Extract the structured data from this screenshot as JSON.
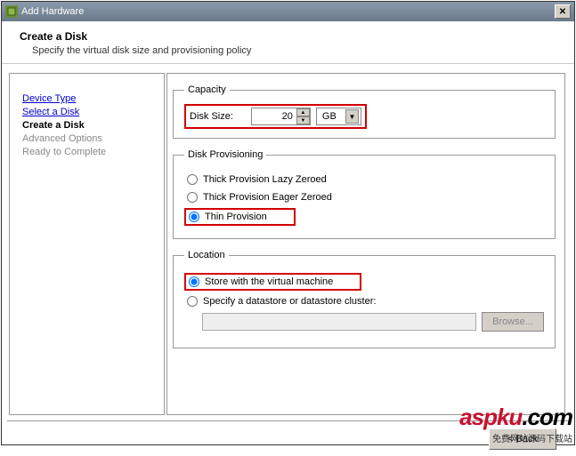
{
  "window": {
    "title": "Add Hardware",
    "close_label": "✕"
  },
  "header": {
    "title": "Create a Disk",
    "subtitle": "Specify the virtual disk size and provisioning policy"
  },
  "nav": {
    "device_type": "Device Type",
    "select_disk": "Select a Disk",
    "create_disk": "Create a Disk",
    "advanced": "Advanced Options",
    "ready": "Ready to Complete"
  },
  "capacity": {
    "legend": "Capacity",
    "label": "Disk Size:",
    "value": "20",
    "unit": "GB"
  },
  "provisioning": {
    "legend": "Disk Provisioning",
    "r1": "Thick Provision Lazy Zeroed",
    "r2": "Thick Provision Eager Zeroed",
    "r3": "Thin Provision"
  },
  "location": {
    "legend": "Location",
    "r1": "Store with the virtual machine",
    "r2": "Specify a datastore or datastore cluster:",
    "browse": "Browse..."
  },
  "footer": {
    "back": "< Back"
  },
  "watermark": {
    "main": "aspku",
    "sub": "免费网站源码下载站"
  }
}
